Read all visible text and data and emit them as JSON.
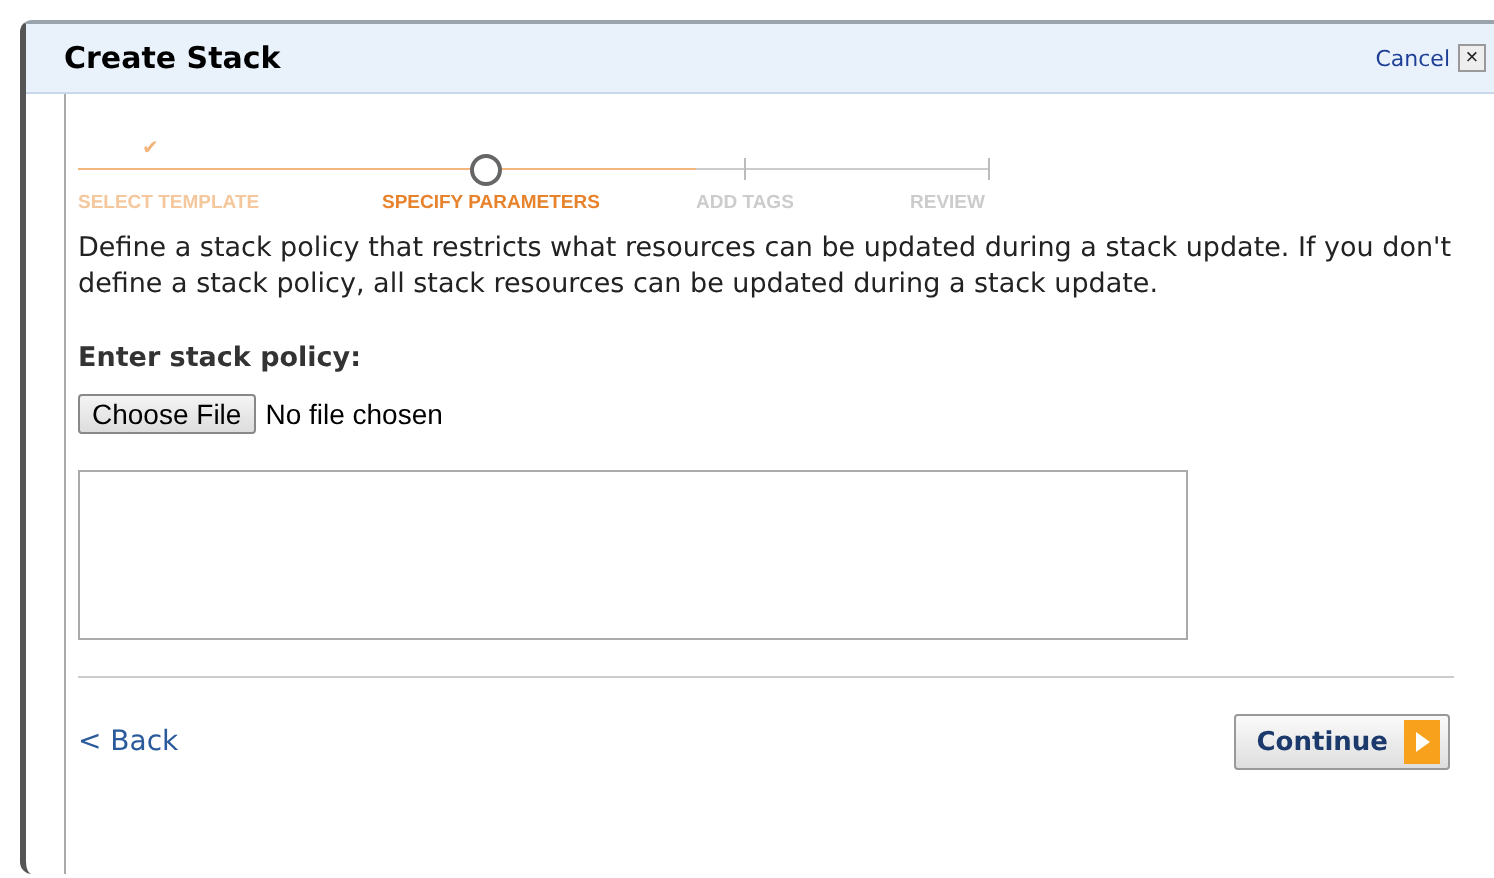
{
  "window": {
    "title": "Create Stack",
    "cancel": "Cancel",
    "close": "×"
  },
  "steps": [
    {
      "label": "SELECT TEMPLATE",
      "kind": "done",
      "mark": "✔"
    },
    {
      "label": "SPECIFY PARAMETERS",
      "kind": "current"
    },
    {
      "label": "ADD TAGS",
      "kind": "upcoming"
    },
    {
      "label": "REVIEW",
      "kind": "upcoming"
    }
  ],
  "description": "Define a stack policy that restricts what resources can be updated during a stack update. If you don't define a stack policy, all stack resources can be updated during a stack update.",
  "policy": {
    "label": "Enter stack policy:",
    "choose_button": "Choose File",
    "file_status": "No file chosen"
  },
  "footer": {
    "back": "< Back",
    "continue": "Continue"
  }
}
